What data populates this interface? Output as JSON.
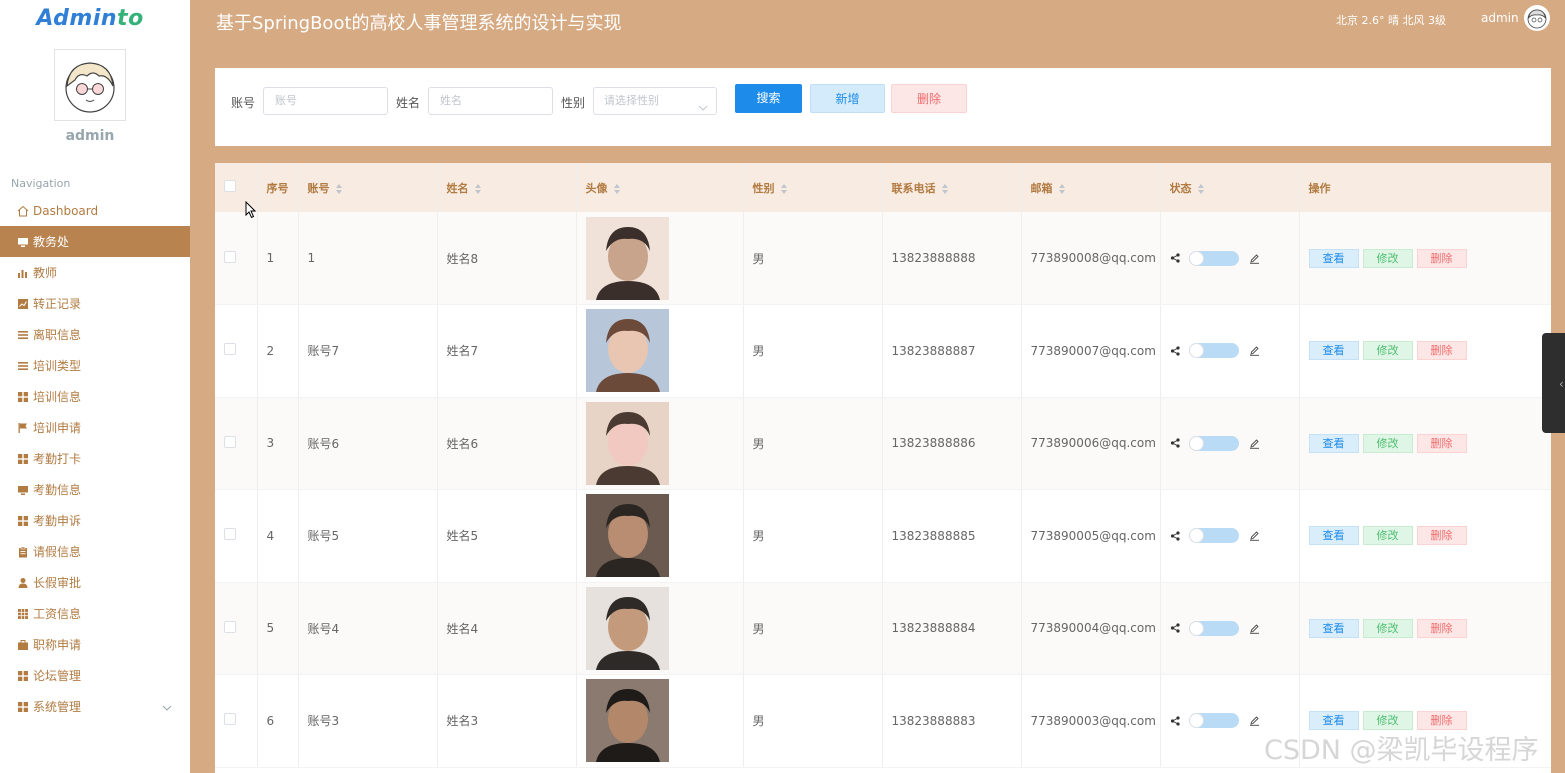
{
  "app": {
    "logo_main": "Admin",
    "logo_accent": "to",
    "title": "基于SpringBoot的高校人事管理系统的设计与实现",
    "weather": "北京  2.6°  晴  北风  3级",
    "user": "admin"
  },
  "sidebar": {
    "username": "admin",
    "nav_title": "Navigation",
    "items": [
      {
        "label": "Dashboard",
        "icon": "home-icon"
      },
      {
        "label": "教务处",
        "icon": "monitor-icon"
      },
      {
        "label": "教师",
        "icon": "bar-chart-icon"
      },
      {
        "label": "转正记录",
        "icon": "line-chart-icon"
      },
      {
        "label": "离职信息",
        "icon": "list-icon"
      },
      {
        "label": "培训类型",
        "icon": "list-icon"
      },
      {
        "label": "培训信息",
        "icon": "grid-icon"
      },
      {
        "label": "培训申请",
        "icon": "flag-icon"
      },
      {
        "label": "考勤打卡",
        "icon": "grid-icon"
      },
      {
        "label": "考勤信息",
        "icon": "monitor-icon"
      },
      {
        "label": "考勤申诉",
        "icon": "grid-icon"
      },
      {
        "label": "请假信息",
        "icon": "clipboard-icon"
      },
      {
        "label": "长假审批",
        "icon": "user-icon"
      },
      {
        "label": "工资信息",
        "icon": "table-icon"
      },
      {
        "label": "职称申请",
        "icon": "briefcase-icon"
      },
      {
        "label": "论坛管理",
        "icon": "grid-icon"
      },
      {
        "label": "系统管理",
        "icon": "grid-icon"
      }
    ]
  },
  "search": {
    "account_label": "账号",
    "account_placeholder": "账号",
    "name_label": "姓名",
    "name_placeholder": "姓名",
    "gender_label": "性别",
    "gender_placeholder": "请选择性别",
    "search_button": "搜索",
    "add_button": "新增",
    "delete_button": "删除"
  },
  "table": {
    "headers": [
      "序号",
      "账号",
      "姓名",
      "头像",
      "性别",
      "联系电话",
      "邮箱",
      "状态",
      "操作"
    ],
    "rows": [
      {
        "index": "1",
        "account": "1",
        "name": "姓名8",
        "gender": "男",
        "phone": "13823888888",
        "email": "773890008@qq.com"
      },
      {
        "index": "2",
        "account": "账号7",
        "name": "姓名7",
        "gender": "男",
        "phone": "13823888887",
        "email": "773890007@qq.com"
      },
      {
        "index": "3",
        "account": "账号6",
        "name": "姓名6",
        "gender": "男",
        "phone": "13823888886",
        "email": "773890006@qq.com"
      },
      {
        "index": "4",
        "account": "账号5",
        "name": "姓名5",
        "gender": "男",
        "phone": "13823888885",
        "email": "773890005@qq.com"
      },
      {
        "index": "5",
        "account": "账号4",
        "name": "姓名4",
        "gender": "男",
        "phone": "13823888884",
        "email": "773890004@qq.com"
      },
      {
        "index": "6",
        "account": "账号3",
        "name": "姓名3",
        "gender": "男",
        "phone": "13823888883",
        "email": "773890003@qq.com"
      }
    ],
    "op_view": "查看",
    "op_edit": "修改",
    "op_delete": "删除"
  },
  "watermark": "CSDN @梁凯毕设程序",
  "colors": {
    "header_bg": "#d6aa82",
    "active_nav": "#b8834f",
    "primary": "#1c8bea",
    "success": "#4cbf70",
    "danger": "#ee6b6b"
  }
}
